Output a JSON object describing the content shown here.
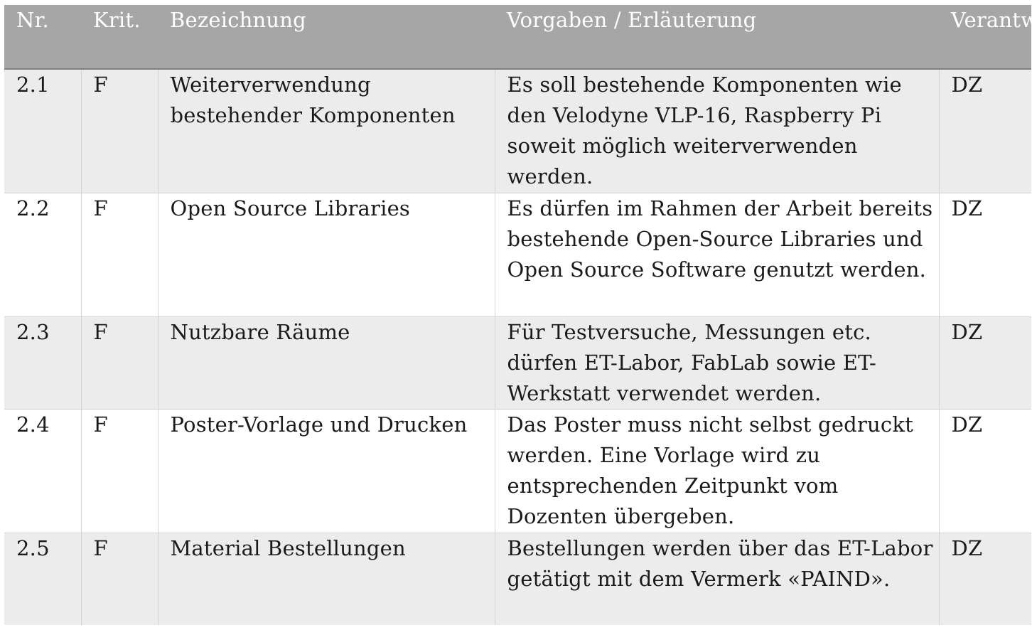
{
  "table": {
    "headers": {
      "nr": "Nr.",
      "krit": "Krit.",
      "bezeichnung": "Bezeichnung",
      "vorgaben": "Vorgaben / Erläuterung",
      "verantw": "Verantw."
    },
    "rows": [
      {
        "nr": "2.1",
        "krit": "F",
        "bezeichnung": "Weiterverwendung bestehender Komponenten",
        "vorgaben": "Es soll bestehende Komponenten wie den Velodyne VLP-16, Raspberry Pi soweit möglich weiterverwenden werden.",
        "verantw": "DZ"
      },
      {
        "nr": "2.2",
        "krit": "F",
        "bezeichnung": "Open Source Libraries",
        "vorgaben": "Es dürfen im Rahmen der Arbeit bereits bestehende Open-Source Libraries und Open Source Software genutzt werden.",
        "verantw": "DZ"
      },
      {
        "nr": "2.3",
        "krit": "F",
        "bezeichnung": "Nutzbare Räume",
        "vorgaben": "Für Testversuche, Messungen etc. dürfen ET-Labor, FabLab sowie ET-Werkstatt verwendet werden.",
        "verantw": "DZ"
      },
      {
        "nr": "2.4",
        "krit": "F",
        "bezeichnung": "Poster-Vorlage und Drucken",
        "vorgaben": "Das Poster muss nicht selbst gedruckt werden. Eine Vorlage wird zu entsprechenden Zeitpunkt vom Dozenten übergeben.",
        "verantw": "DZ"
      },
      {
        "nr": "2.5",
        "krit": "F",
        "bezeichnung": "Material Bestellungen",
        "vorgaben": "Bestellungen werden über das ET-Labor getätigt mit dem Vermerk «PAIND».",
        "verantw": "DZ"
      }
    ]
  }
}
